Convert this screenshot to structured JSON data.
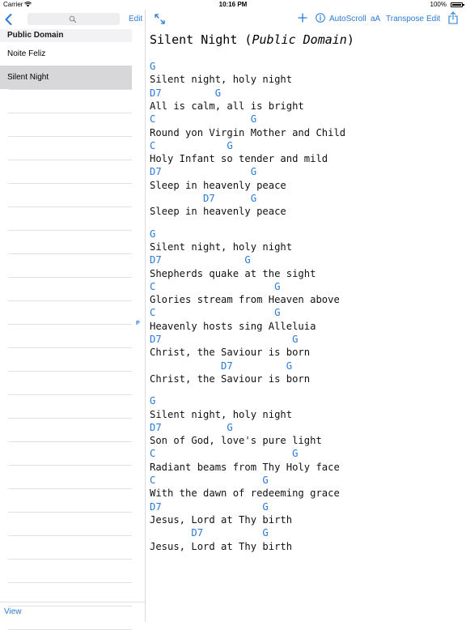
{
  "status_bar": {
    "carrier": "Carrier",
    "time": "10:16 PM",
    "battery": "100%"
  },
  "sidebar": {
    "edit_label": "Edit",
    "search_placeholder": "",
    "section_header": "Public Domain",
    "songs": [
      {
        "title": "Noite Feliz",
        "selected": false
      },
      {
        "title": "Silent Night",
        "selected": true
      }
    ],
    "index_letter": "P",
    "view_label": "View"
  },
  "toolbar": {
    "autoscroll_label": "AutoScroll",
    "font_size_label": "aA",
    "transpose_label": "Transpose",
    "edit_label": "Edit"
  },
  "song": {
    "title": "Silent Night",
    "subtitle": "Public Domain",
    "lines": [
      {
        "type": "chord",
        "text": "G"
      },
      {
        "type": "lyric",
        "text": "Silent night, holy night"
      },
      {
        "type": "chord",
        "text": "D7         G"
      },
      {
        "type": "lyric",
        "text": "All is calm, all is bright"
      },
      {
        "type": "chord",
        "text": "C                G"
      },
      {
        "type": "lyric",
        "text": "Round yon Virgin Mother and Child"
      },
      {
        "type": "chord",
        "text": "C            G"
      },
      {
        "type": "lyric",
        "text": "Holy Infant so tender and mild"
      },
      {
        "type": "chord",
        "text": "D7               G"
      },
      {
        "type": "lyric",
        "text": "Sleep in heavenly peace"
      },
      {
        "type": "chord",
        "text": "         D7      G"
      },
      {
        "type": "lyric",
        "text": "Sleep in heavenly peace"
      },
      {
        "type": "blank",
        "text": ""
      },
      {
        "type": "chord",
        "text": "G"
      },
      {
        "type": "lyric",
        "text": "Silent night, holy night"
      },
      {
        "type": "chord",
        "text": "D7              G"
      },
      {
        "type": "lyric",
        "text": "Shepherds quake at the sight"
      },
      {
        "type": "chord",
        "text": "C                    G"
      },
      {
        "type": "lyric",
        "text": "Glories stream from Heaven above"
      },
      {
        "type": "chord",
        "text": "C                    G"
      },
      {
        "type": "lyric",
        "text": "Heavenly hosts sing Alleluia"
      },
      {
        "type": "chord",
        "text": "D7                      G"
      },
      {
        "type": "lyric",
        "text": "Christ, the Saviour is born"
      },
      {
        "type": "chord",
        "text": "            D7         G"
      },
      {
        "type": "lyric",
        "text": "Christ, the Saviour is born"
      },
      {
        "type": "blank",
        "text": ""
      },
      {
        "type": "chord",
        "text": "G"
      },
      {
        "type": "lyric",
        "text": "Silent night, holy night"
      },
      {
        "type": "chord",
        "text": "D7           G"
      },
      {
        "type": "lyric",
        "text": "Son of God, love's pure light"
      },
      {
        "type": "chord",
        "text": "C                       G"
      },
      {
        "type": "lyric",
        "text": "Radiant beams from Thy Holy face"
      },
      {
        "type": "chord",
        "text": "C                  G"
      },
      {
        "type": "lyric",
        "text": "With the dawn of redeeming grace"
      },
      {
        "type": "chord",
        "text": "D7                 G"
      },
      {
        "type": "lyric",
        "text": "Jesus, Lord at Thy birth"
      },
      {
        "type": "chord",
        "text": "       D7          G"
      },
      {
        "type": "lyric",
        "text": "Jesus, Lord at Thy birth"
      }
    ]
  },
  "colors": {
    "accent": "#2a7ad6",
    "selected_row": "#d7d7d9",
    "section_header_bg": "#f2f2f4"
  },
  "icons": {
    "back": "chevron-left-icon",
    "search": "magnifier-icon",
    "expand": "expand-arrows-icon",
    "add": "plus-icon",
    "info": "info-circle-icon",
    "share": "share-icon",
    "wifi": "wifi-icon",
    "battery": "battery-icon"
  }
}
